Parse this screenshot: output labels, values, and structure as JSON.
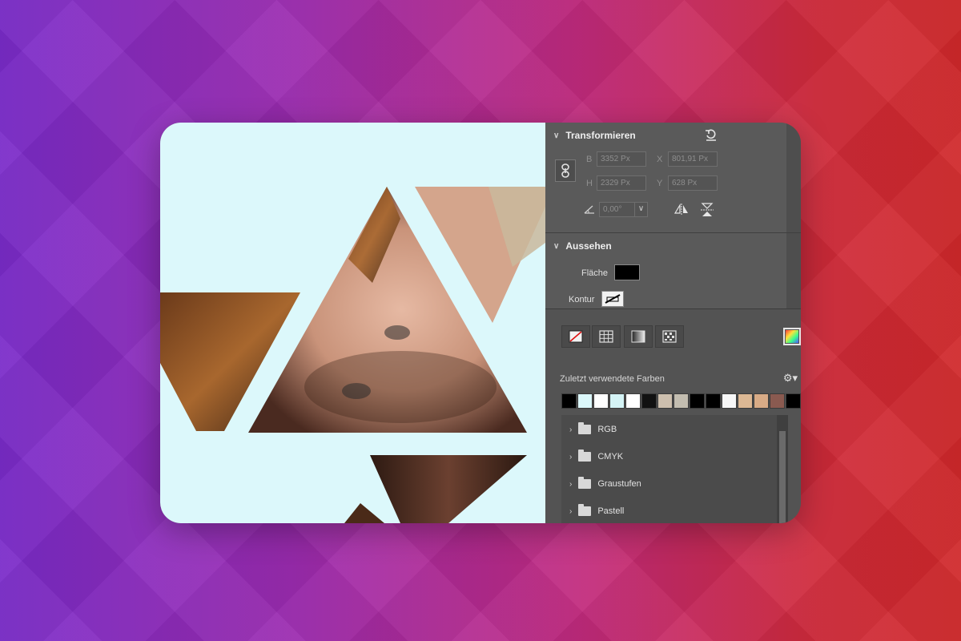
{
  "transform": {
    "title": "Transformieren",
    "b_label": "B",
    "b_value": "3352 Px",
    "x_label": "X",
    "x_value": "801,91 Px",
    "h_label": "H",
    "h_value": "2329 Px",
    "y_label": "Y",
    "y_value": "628 Px",
    "angle_value": "0,00°"
  },
  "appearance": {
    "title": "Aussehen",
    "fill_label": "Fläche",
    "fill_color": "#000000",
    "stroke_label": "Kontur"
  },
  "colors": {
    "recent_label": "Zuletzt verwendete Farben",
    "recent_swatches": [
      "#000000",
      "#dcf8fb",
      "#ffffff",
      "#d4f3f5",
      "#ffffff",
      "#111111",
      "#cdbfae",
      "#c3bdb0",
      "#000000",
      "#000000",
      "#f7f7f7",
      "#dcb894",
      "#d8ab86",
      "#8a5a50",
      "#000000"
    ],
    "folders": [
      {
        "label": "RGB"
      },
      {
        "label": "CMYK"
      },
      {
        "label": "Graustufen"
      },
      {
        "label": "Pastell"
      }
    ]
  },
  "canvas": {
    "background": "#dcf8fb"
  }
}
